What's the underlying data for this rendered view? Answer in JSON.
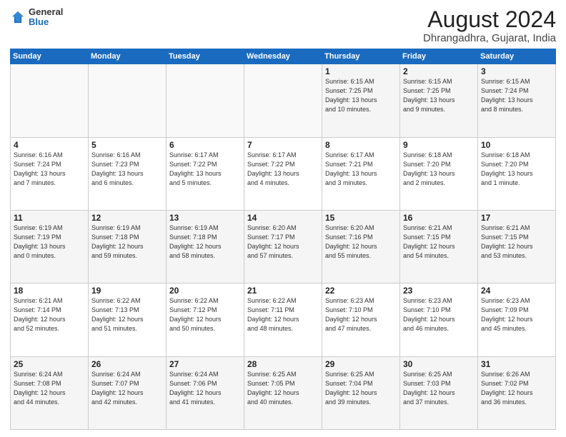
{
  "header": {
    "logo_general": "General",
    "logo_blue": "Blue",
    "title": "August 2024",
    "subtitle": "Dhrangadhra, Gujarat, India"
  },
  "calendar": {
    "days_of_week": [
      "Sunday",
      "Monday",
      "Tuesday",
      "Wednesday",
      "Thursday",
      "Friday",
      "Saturday"
    ],
    "weeks": [
      [
        {
          "day": "",
          "info": ""
        },
        {
          "day": "",
          "info": ""
        },
        {
          "day": "",
          "info": ""
        },
        {
          "day": "",
          "info": ""
        },
        {
          "day": "1",
          "info": "Sunrise: 6:15 AM\nSunset: 7:25 PM\nDaylight: 13 hours\nand 10 minutes."
        },
        {
          "day": "2",
          "info": "Sunrise: 6:15 AM\nSunset: 7:25 PM\nDaylight: 13 hours\nand 9 minutes."
        },
        {
          "day": "3",
          "info": "Sunrise: 6:15 AM\nSunset: 7:24 PM\nDaylight: 13 hours\nand 8 minutes."
        }
      ],
      [
        {
          "day": "4",
          "info": "Sunrise: 6:16 AM\nSunset: 7:24 PM\nDaylight: 13 hours\nand 7 minutes."
        },
        {
          "day": "5",
          "info": "Sunrise: 6:16 AM\nSunset: 7:23 PM\nDaylight: 13 hours\nand 6 minutes."
        },
        {
          "day": "6",
          "info": "Sunrise: 6:17 AM\nSunset: 7:22 PM\nDaylight: 13 hours\nand 5 minutes."
        },
        {
          "day": "7",
          "info": "Sunrise: 6:17 AM\nSunset: 7:22 PM\nDaylight: 13 hours\nand 4 minutes."
        },
        {
          "day": "8",
          "info": "Sunrise: 6:17 AM\nSunset: 7:21 PM\nDaylight: 13 hours\nand 3 minutes."
        },
        {
          "day": "9",
          "info": "Sunrise: 6:18 AM\nSunset: 7:20 PM\nDaylight: 13 hours\nand 2 minutes."
        },
        {
          "day": "10",
          "info": "Sunrise: 6:18 AM\nSunset: 7:20 PM\nDaylight: 13 hours\nand 1 minute."
        }
      ],
      [
        {
          "day": "11",
          "info": "Sunrise: 6:19 AM\nSunset: 7:19 PM\nDaylight: 13 hours\nand 0 minutes."
        },
        {
          "day": "12",
          "info": "Sunrise: 6:19 AM\nSunset: 7:18 PM\nDaylight: 12 hours\nand 59 minutes."
        },
        {
          "day": "13",
          "info": "Sunrise: 6:19 AM\nSunset: 7:18 PM\nDaylight: 12 hours\nand 58 minutes."
        },
        {
          "day": "14",
          "info": "Sunrise: 6:20 AM\nSunset: 7:17 PM\nDaylight: 12 hours\nand 57 minutes."
        },
        {
          "day": "15",
          "info": "Sunrise: 6:20 AM\nSunset: 7:16 PM\nDaylight: 12 hours\nand 55 minutes."
        },
        {
          "day": "16",
          "info": "Sunrise: 6:21 AM\nSunset: 7:15 PM\nDaylight: 12 hours\nand 54 minutes."
        },
        {
          "day": "17",
          "info": "Sunrise: 6:21 AM\nSunset: 7:15 PM\nDaylight: 12 hours\nand 53 minutes."
        }
      ],
      [
        {
          "day": "18",
          "info": "Sunrise: 6:21 AM\nSunset: 7:14 PM\nDaylight: 12 hours\nand 52 minutes."
        },
        {
          "day": "19",
          "info": "Sunrise: 6:22 AM\nSunset: 7:13 PM\nDaylight: 12 hours\nand 51 minutes."
        },
        {
          "day": "20",
          "info": "Sunrise: 6:22 AM\nSunset: 7:12 PM\nDaylight: 12 hours\nand 50 minutes."
        },
        {
          "day": "21",
          "info": "Sunrise: 6:22 AM\nSunset: 7:11 PM\nDaylight: 12 hours\nand 48 minutes."
        },
        {
          "day": "22",
          "info": "Sunrise: 6:23 AM\nSunset: 7:10 PM\nDaylight: 12 hours\nand 47 minutes."
        },
        {
          "day": "23",
          "info": "Sunrise: 6:23 AM\nSunset: 7:10 PM\nDaylight: 12 hours\nand 46 minutes."
        },
        {
          "day": "24",
          "info": "Sunrise: 6:23 AM\nSunset: 7:09 PM\nDaylight: 12 hours\nand 45 minutes."
        }
      ],
      [
        {
          "day": "25",
          "info": "Sunrise: 6:24 AM\nSunset: 7:08 PM\nDaylight: 12 hours\nand 44 minutes."
        },
        {
          "day": "26",
          "info": "Sunrise: 6:24 AM\nSunset: 7:07 PM\nDaylight: 12 hours\nand 42 minutes."
        },
        {
          "day": "27",
          "info": "Sunrise: 6:24 AM\nSunset: 7:06 PM\nDaylight: 12 hours\nand 41 minutes."
        },
        {
          "day": "28",
          "info": "Sunrise: 6:25 AM\nSunset: 7:05 PM\nDaylight: 12 hours\nand 40 minutes."
        },
        {
          "day": "29",
          "info": "Sunrise: 6:25 AM\nSunset: 7:04 PM\nDaylight: 12 hours\nand 39 minutes."
        },
        {
          "day": "30",
          "info": "Sunrise: 6:25 AM\nSunset: 7:03 PM\nDaylight: 12 hours\nand 37 minutes."
        },
        {
          "day": "31",
          "info": "Sunrise: 6:26 AM\nSunset: 7:02 PM\nDaylight: 12 hours\nand 36 minutes."
        }
      ]
    ]
  }
}
